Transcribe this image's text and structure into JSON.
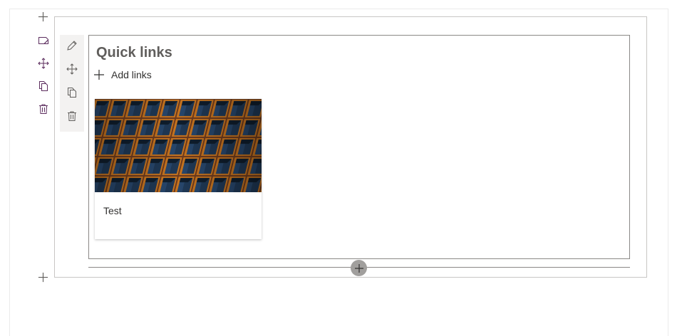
{
  "webpart": {
    "title": "Quick links",
    "add_links_label": "Add links"
  },
  "card": {
    "title": "Test",
    "image_alt": "Building facade with rows of windows"
  },
  "icons": {
    "add_section_top": "plus-icon",
    "section_edit": "edit-section-icon",
    "section_move": "move-icon",
    "section_duplicate": "copy-icon",
    "section_delete": "delete-icon",
    "webpart_edit": "pencil-icon",
    "webpart_move": "move-icon",
    "webpart_duplicate": "copy-icon",
    "webpart_delete": "delete-icon",
    "add_webpart": "plus-icon",
    "add_section_bottom": "plus-icon"
  },
  "colors": {
    "icon_accent": "#5c2d5e",
    "border": "#8a8886",
    "toolbar_bg": "#f3f2f1",
    "add_circle": "#a19f9d"
  }
}
